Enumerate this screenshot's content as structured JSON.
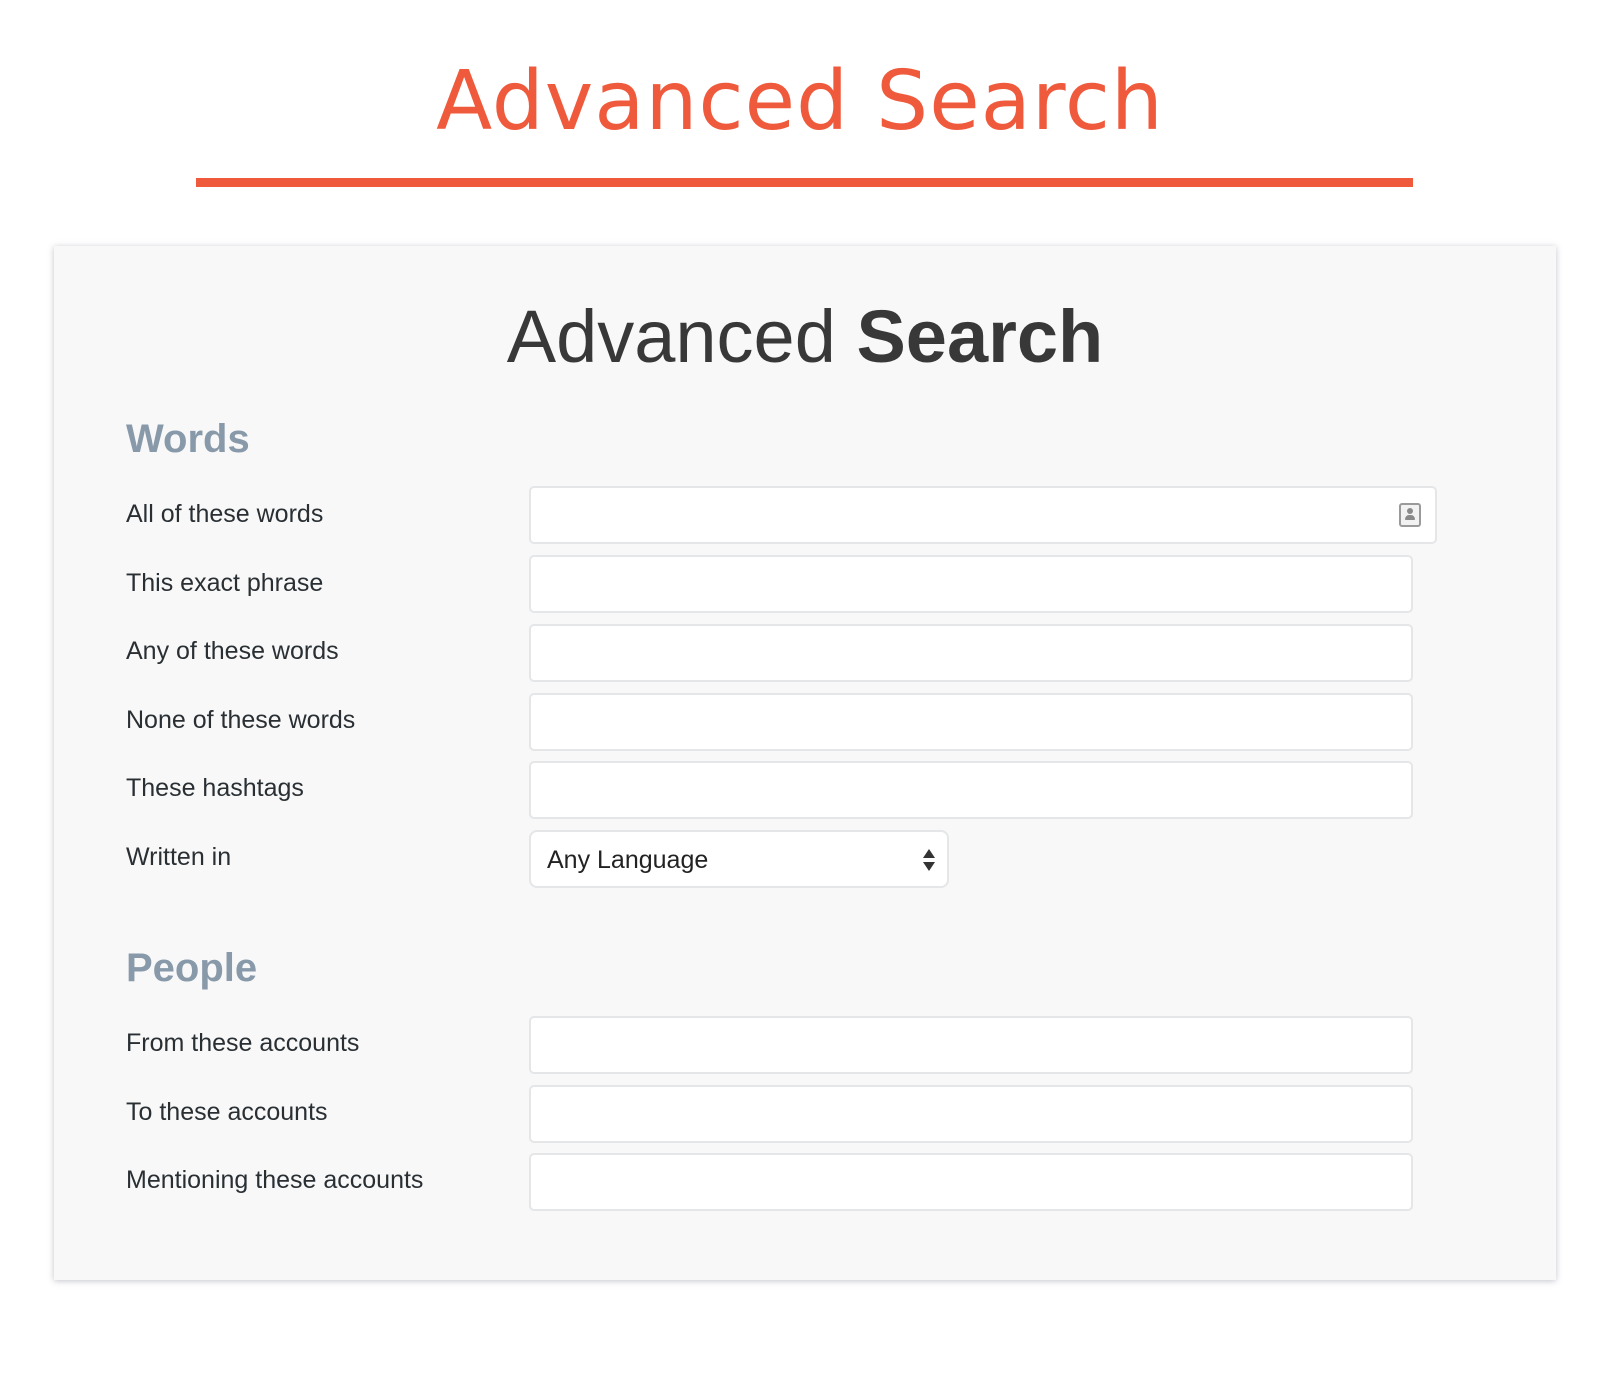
{
  "banner": {
    "title": "Advanced Search"
  },
  "card": {
    "title_light": "Advanced",
    "title_bold": "Search"
  },
  "sections": {
    "words": {
      "heading": "Words",
      "all_words_label": "All of these words",
      "all_words_value": "",
      "exact_phrase_label": "This exact phrase",
      "exact_phrase_value": "",
      "any_words_label": "Any of these words",
      "any_words_value": "",
      "none_words_label": "None of these words",
      "none_words_value": "",
      "hashtags_label": "These hashtags",
      "hashtags_value": "",
      "language_label": "Written in",
      "language_selected": "Any Language"
    },
    "people": {
      "heading": "People",
      "from_label": "From these accounts",
      "from_value": "",
      "to_label": "To these accounts",
      "to_value": "",
      "mentioning_label": "Mentioning these accounts",
      "mentioning_value": ""
    }
  },
  "colors": {
    "accent": "#f05a3c",
    "section_heading": "#8899aa",
    "card_background": "#f8f8f8",
    "label_text": "#292f33"
  },
  "icons": {
    "autofill": "contact-card-icon",
    "select_toggle": "up-down-arrows-icon"
  }
}
